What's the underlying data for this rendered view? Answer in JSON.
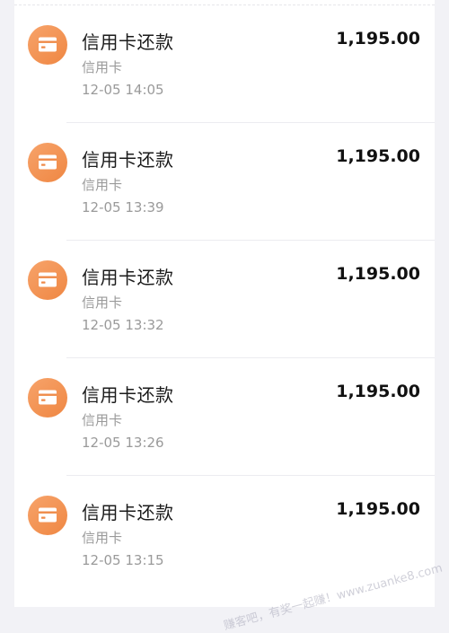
{
  "transactions": [
    {
      "title": "信用卡还款",
      "category": "信用卡",
      "time": "12-05 14:05",
      "amount": "1,195.00",
      "icon": "card-icon"
    },
    {
      "title": "信用卡还款",
      "category": "信用卡",
      "time": "12-05 13:39",
      "amount": "1,195.00",
      "icon": "card-icon"
    },
    {
      "title": "信用卡还款",
      "category": "信用卡",
      "time": "12-05 13:32",
      "amount": "1,195.00",
      "icon": "card-icon"
    },
    {
      "title": "信用卡还款",
      "category": "信用卡",
      "time": "12-05 13:26",
      "amount": "1,195.00",
      "icon": "card-icon"
    },
    {
      "title": "信用卡还款",
      "category": "信用卡",
      "time": "12-05 13:15",
      "amount": "1,195.00",
      "icon": "card-icon"
    }
  ],
  "watermark": "赚客吧，有奖一起赚！www.zuanke8.com",
  "colors": {
    "icon_gradient_start": "#f7a36a",
    "icon_gradient_end": "#ef8743",
    "background": "#f2f2f6",
    "card": "#ffffff"
  }
}
